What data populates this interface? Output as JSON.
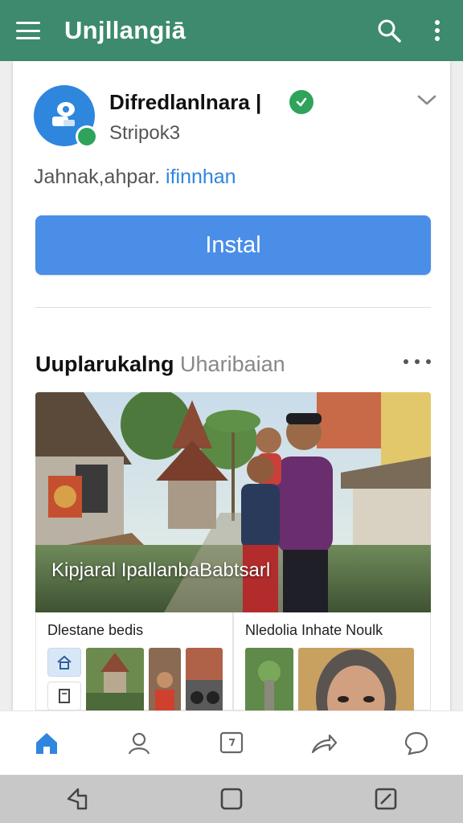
{
  "appbar": {
    "title": "Unjllangiā",
    "menu_icon": "hamburger-menu-icon",
    "search_icon": "search-icon",
    "more_icon": "more-vert-icon",
    "color": "#3d8a6e"
  },
  "app": {
    "name": "Difredlanlnara |",
    "developer": "Stripok3",
    "description_text": "Jahnak,ahpar. ",
    "description_link": "ifinnhan",
    "install_label": "Instal",
    "install_color": "#4a8ee8"
  },
  "section": {
    "title_bold": "Uuplarukalng",
    "title_sub": "Uharibaian"
  },
  "hero": {
    "caption": "Kipjaral  IpallanbaBabtsarl"
  },
  "subcards": [
    {
      "label": "Dlestane bedis"
    },
    {
      "label": "Nledolia  Inhate Noulk"
    }
  ],
  "bottom_nav": {
    "items": [
      "home-icon",
      "person-icon",
      "chat-square-icon",
      "share-icon",
      "chat-bubble-icon"
    ],
    "active_color": "#2f86dd"
  },
  "system_nav": [
    "back-icon",
    "home-square-icon",
    "recents-icon"
  ]
}
